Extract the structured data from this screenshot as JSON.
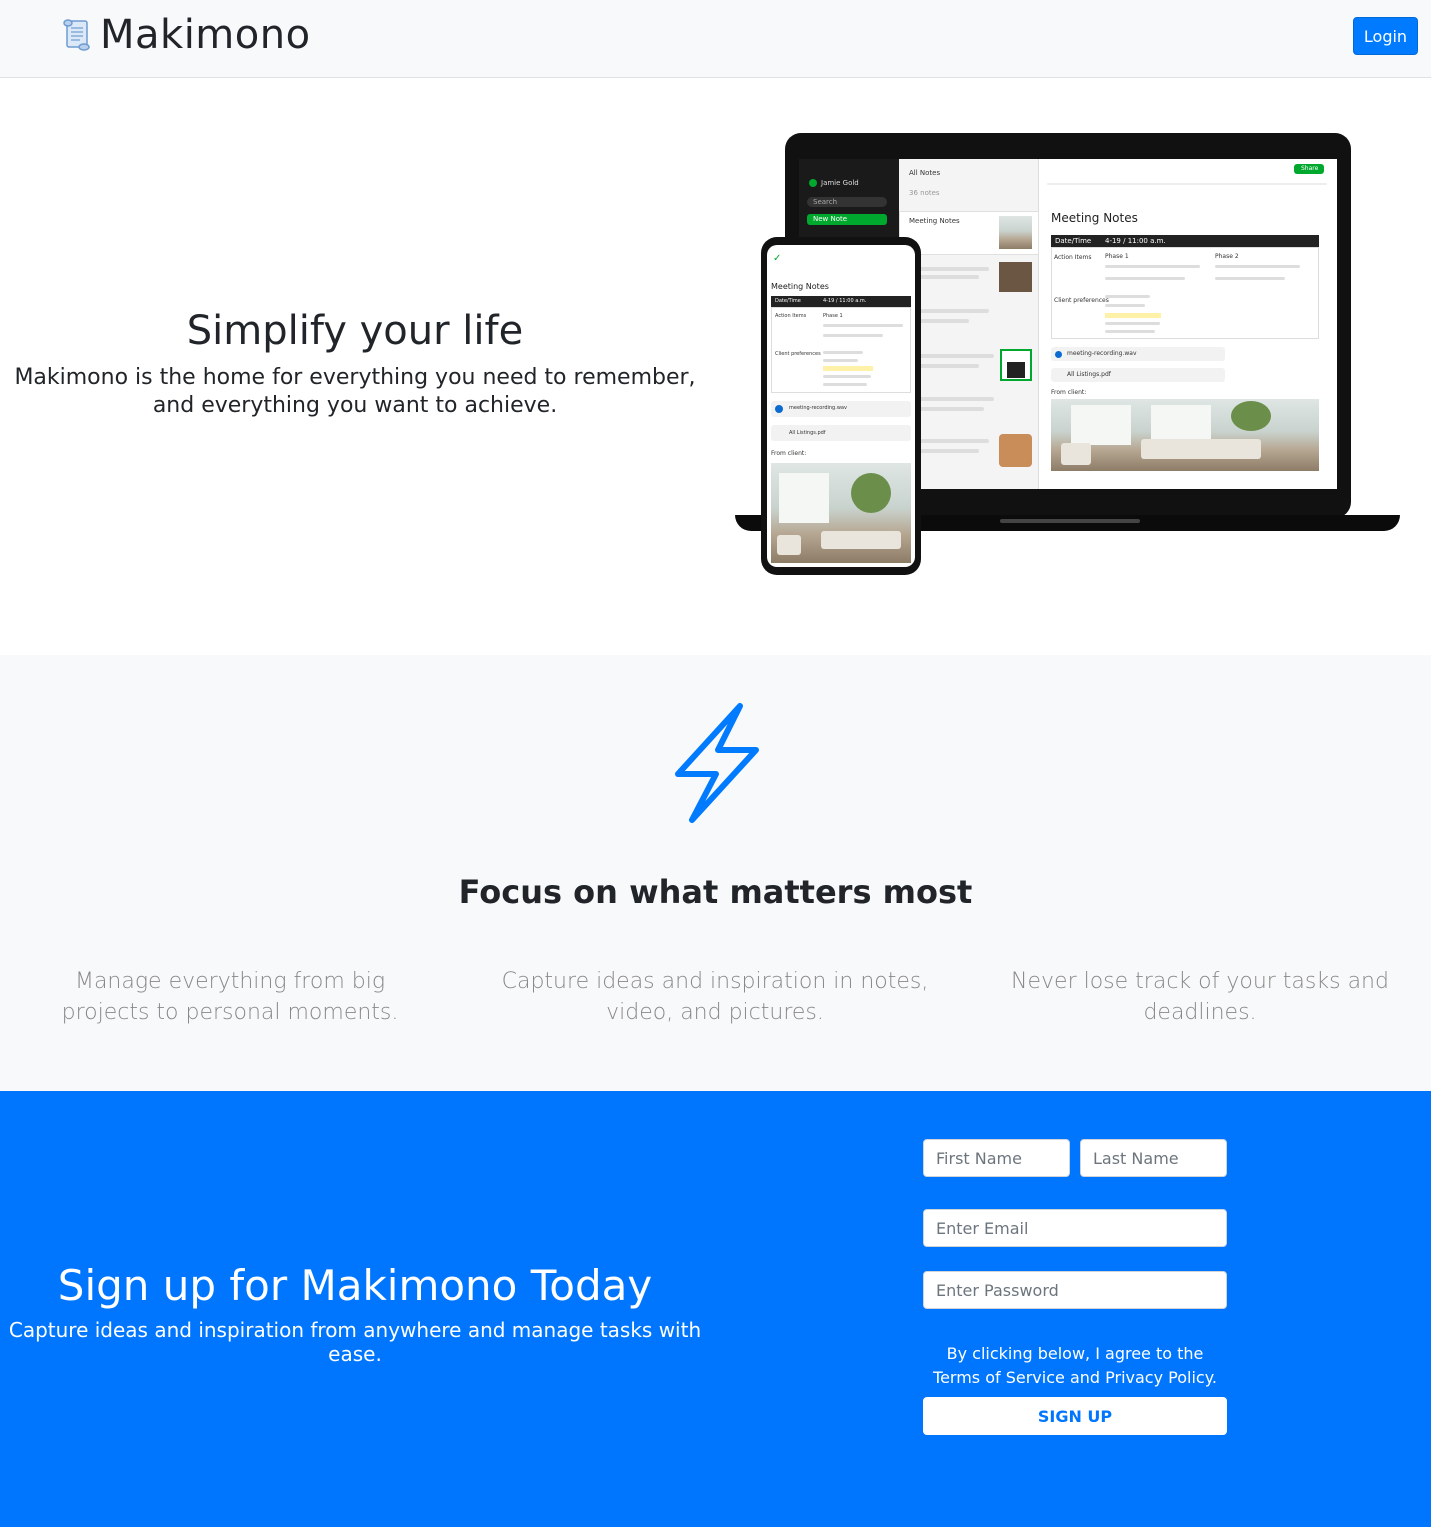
{
  "navbar": {
    "brand_name": "Makimono",
    "brand_icon": "scroll-icon",
    "login_label": "Login"
  },
  "hero": {
    "title": "Simplify your life",
    "subtitle": "Makimono is the home for everything you need to remember, and everything you want to achieve.",
    "mockup": {
      "laptop": {
        "sidebar_user": "Jamie Gold",
        "sidebar_search": "Search",
        "sidebar_new_note": "New Note",
        "list_header": "All Notes",
        "list_count": "36 notes",
        "list_item_title": "Meeting Notes",
        "note_title": "Meeting Notes",
        "share_label": "Share",
        "table_header_left": "Date/Time",
        "table_header_right": "4-19 / 11:00 a.m.",
        "action_items": "Action Items",
        "phase1": "Phase 1",
        "phase2": "Phase 2",
        "client_prefs": "Client preferences",
        "attachment1": "meeting-recording.wav",
        "attachment2": "All Listings.pdf",
        "from_client": "From client:"
      },
      "phone": {
        "note_title": "Meeting Notes",
        "table_header_left": "Date/Time",
        "table_header_right": "4-19 / 11:00 a.m.",
        "action_items": "Action Items",
        "phase1": "Phase 1",
        "client_prefs": "Client preferences",
        "attachment1": "meeting-recording.wav",
        "attachment2": "All Listings.pdf",
        "from_client": "From client:"
      }
    }
  },
  "features": {
    "icon": "lightning-icon",
    "title": "Focus on what matters most",
    "columns": [
      "Manage everything from big projects to personal moments.",
      "Capture ideas and inspiration in notes, video, and pictures.",
      "Never lose track of your tasks and deadlines."
    ]
  },
  "signup": {
    "title": "Sign up for Makimono Today",
    "subtitle": "Capture ideas and inspiration from anywhere and manage tasks with ease.",
    "first_name_placeholder": "First Name",
    "last_name_placeholder": "Last Name",
    "email_placeholder": "Enter Email",
    "password_placeholder": "Enter Password",
    "terms": "By clicking below, I agree to the Terms of Service and Privacy Policy.",
    "button_label": "SIGN UP"
  },
  "colors": {
    "primary": "#007bff",
    "signup_bg": "#0076ff",
    "features_bg": "#f8f9fa"
  }
}
